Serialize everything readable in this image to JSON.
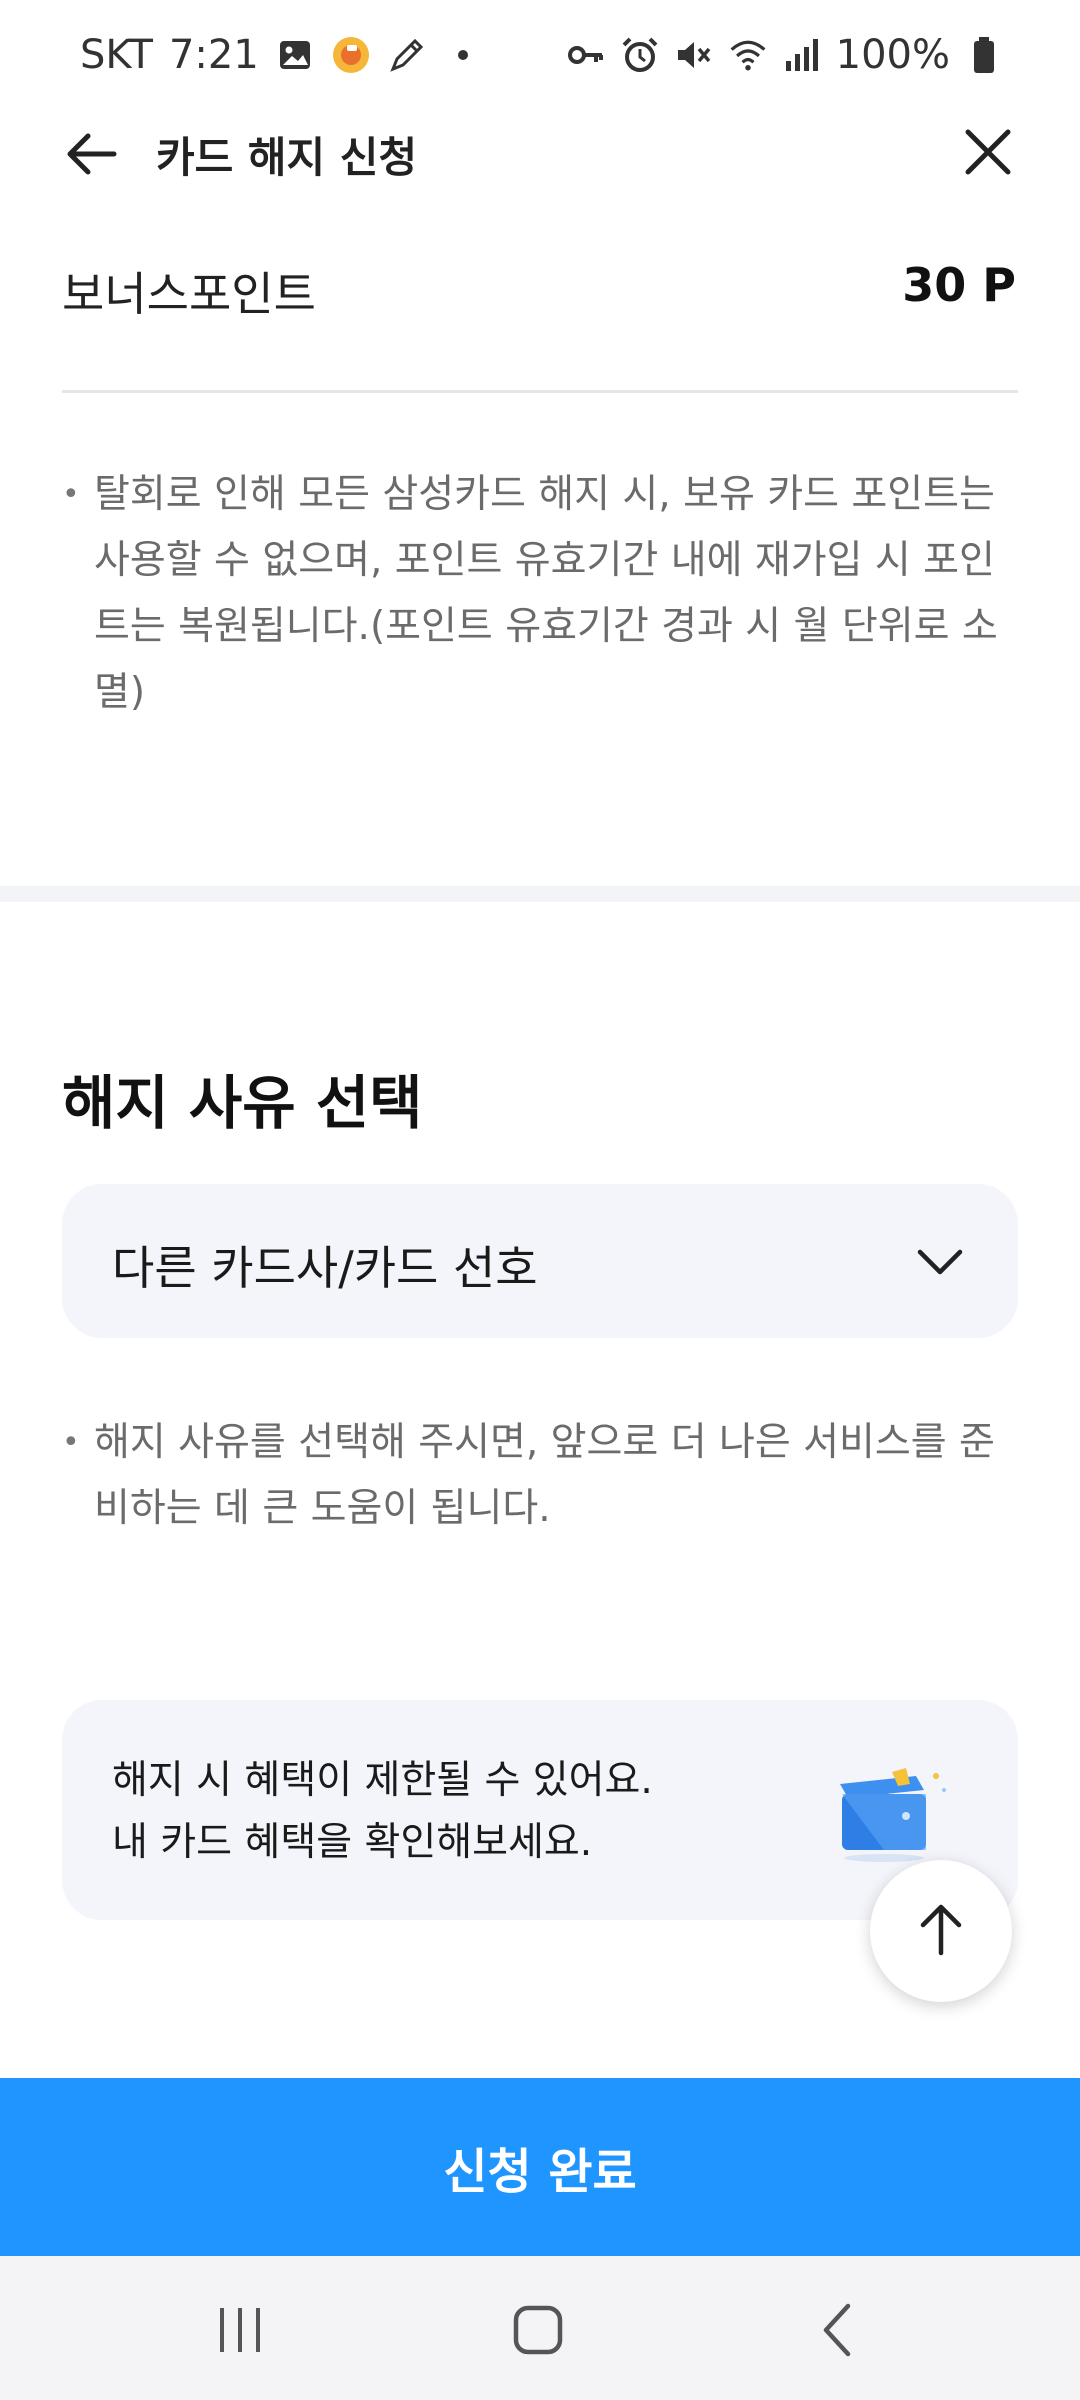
{
  "status_bar": {
    "carrier": "SKT",
    "time": "7:21",
    "battery": "100%",
    "left_icons": [
      "gallery-icon",
      "app-notification-icon",
      "pencil-icon",
      "dot-icon"
    ],
    "right_icons": [
      "vpn-key-icon",
      "alarm-icon",
      "mute-icon",
      "wifi-icon",
      "signal-icon",
      "battery-icon"
    ]
  },
  "header": {
    "title": "카드 해지 신청"
  },
  "points": {
    "label": "보너스포인트",
    "value": "30 P"
  },
  "notice1": {
    "bullet": "•",
    "text": "탈회로 인해 모든 삼성카드 해지 시, 보유 카드 포인트는 사용할 수 없으며, 포인트 유효기간 내에 재가입 시 포인트는 복원됩니다.(포인트 유효기간 경과 시 월 단위로 소멸)"
  },
  "reason_section": {
    "title": "해지 사유 선택",
    "selected": "다른 카드사/카드 선호"
  },
  "notice2": {
    "bullet": "•",
    "text": "해지 사유를 선택해 주시면, 앞으로 더 나은 서비스를 준비하는 데 큰 도움이 됩니다."
  },
  "benefit": {
    "line1": "해지 시 혜택이 제한될 수 있어요.",
    "line2": "내 카드 혜택을 확인해보세요."
  },
  "submit": {
    "label": "신청 완료"
  },
  "colors": {
    "primary": "#1f95ff",
    "box_bg": "#f4f5fa",
    "muted_text": "#6b6b6b"
  }
}
